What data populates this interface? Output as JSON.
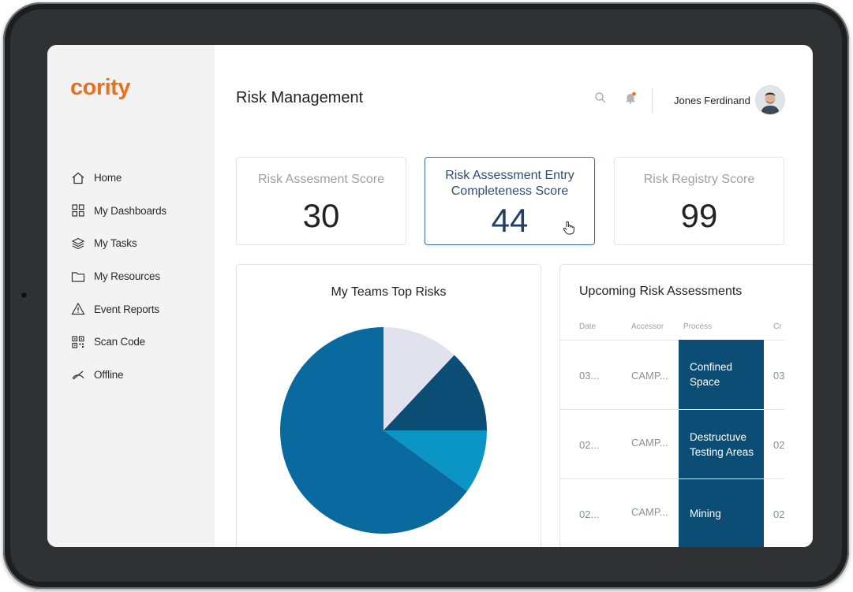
{
  "app": {
    "logo_text": "cority",
    "brand_color": "#e8711e",
    "accent_color": "#0b4d75"
  },
  "sidebar": {
    "items": [
      {
        "label": "Home",
        "icon": "home-icon"
      },
      {
        "label": "My Dashboards",
        "icon": "grid-icon"
      },
      {
        "label": "My Tasks",
        "icon": "layers-icon"
      },
      {
        "label": "My Resources",
        "icon": "folder-icon"
      },
      {
        "label": "Event Reports",
        "icon": "warning-icon"
      },
      {
        "label": "Scan Code",
        "icon": "qr-code-icon"
      },
      {
        "label": "Offline",
        "icon": "offline-icon"
      }
    ]
  },
  "header": {
    "title": "Risk Management",
    "user_name": "Jones Ferdinand",
    "search_icon": "search-icon",
    "notification_icon": "bell-icon"
  },
  "score_cards": [
    {
      "label": "Risk Assesment Score",
      "value": "30"
    },
    {
      "label": "Risk Assessment Entry Completeness Score",
      "value": "44"
    },
    {
      "label": "Risk Registry Score",
      "value": "99"
    }
  ],
  "top_risks": {
    "title": "My Teams Top Risks"
  },
  "chart_data": {
    "type": "pie",
    "title": "My Teams Top Risks",
    "slices": [
      {
        "value": 12,
        "color": "#e2e2ee"
      },
      {
        "value": 13,
        "color": "#0b4d75"
      },
      {
        "value": 10,
        "color": "#0a95c4"
      },
      {
        "value": 65,
        "color": "#0a6aa0"
      }
    ]
  },
  "upcoming": {
    "title": "Upcoming Risk Assessments",
    "columns": [
      "Date",
      "Accessor",
      "Process",
      "Cr"
    ],
    "rows": [
      {
        "date": "03...",
        "accessor": "CAMP...",
        "process": "Confined Space",
        "extra": "03"
      },
      {
        "date": "02...",
        "accessor": "CAMP...",
        "process": "Destructuve Testing Areas",
        "extra": "02"
      },
      {
        "date": "02...",
        "accessor": "CAMP...",
        "process": "Mining",
        "extra": "02"
      }
    ]
  }
}
